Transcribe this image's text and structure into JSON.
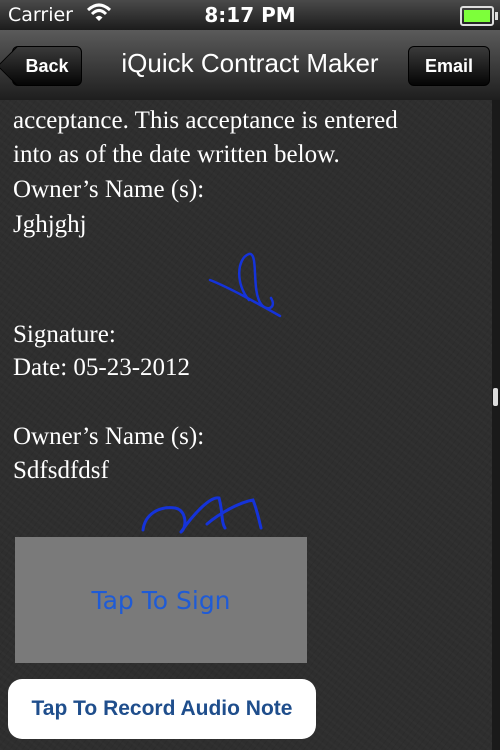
{
  "status_bar": {
    "carrier": "Carrier",
    "time": "8:17 PM",
    "icons": [
      "wifi-icon",
      "battery-icon"
    ]
  },
  "nav": {
    "back_label": "Back",
    "title": "iQuick Contract Maker",
    "email_label": "Email"
  },
  "document": {
    "lines": [
      "acceptance. This acceptance is entered",
      "into as of the date written below.",
      "Owner’s Name (s):",
      "Jghjghj",
      "Signature:",
      "Date: 05-23-2012",
      "Owner’s Name (s):",
      "Sdfsdfdsf"
    ],
    "signature_color": "#1533d9"
  },
  "sign_area": {
    "label": "Tap To Sign"
  },
  "audio_button": {
    "label": "Tap To Record Audio Note"
  }
}
